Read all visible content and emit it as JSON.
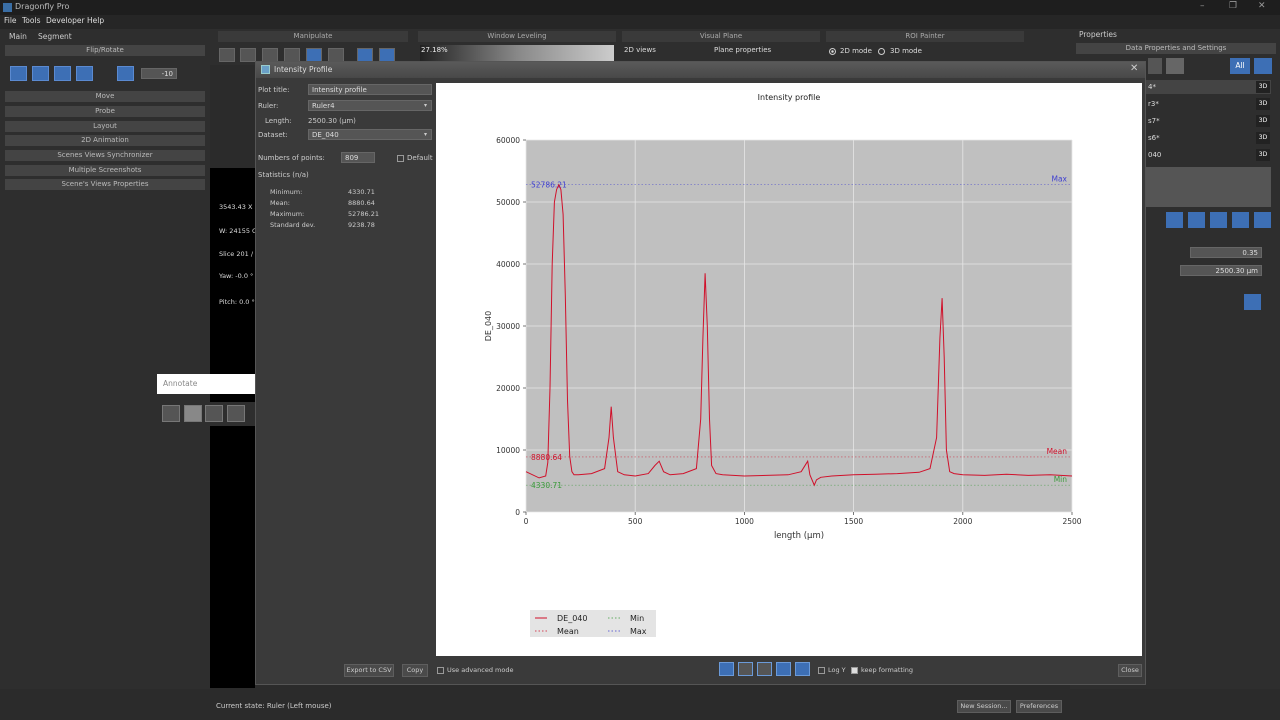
{
  "app": {
    "title": "Dragonfly Pro",
    "win_controls": [
      "–",
      "❐",
      "✕"
    ]
  },
  "menubar": {
    "items": [
      "File",
      "Tools",
      "Developer",
      "Help"
    ]
  },
  "left_panel": {
    "tabs": [
      "Main",
      "Segment"
    ],
    "flip_rotate_header": "Flip/Rotate",
    "rotate_value": "-10",
    "sections": [
      "Move",
      "Probe",
      "Layout",
      "2D Animation",
      "Scenes Views Synchronizer",
      "Multiple Screenshots",
      "Scene's Views Properties"
    ]
  },
  "viewer": {
    "lines": [
      "3543.43 X 2",
      "W: 24155 C",
      "Slice 201 /",
      "Yaw: -0.0 °",
      "Pitch: 0.0 °"
    ]
  },
  "annotate": {
    "label": "Annotate"
  },
  "top_strip": {
    "headers": [
      "Manipulate",
      "Window Leveling",
      "Visual Plane",
      "ROI Painter"
    ],
    "window_level_text": "27.18%",
    "views_2d": "2D views",
    "plane_properties": "Plane properties",
    "mode_2d": "2D mode",
    "mode_3d": "3D mode"
  },
  "right_panel": {
    "header": "Properties",
    "subheader": "Data Properties and Settings",
    "all_btn": "All",
    "rows": [
      {
        "name": "4*",
        "tag": "3D"
      },
      {
        "name": "r3*",
        "tag": "3D"
      },
      {
        "name": "s7*",
        "tag": "3D"
      },
      {
        "name": "s6*",
        "tag": "3D"
      },
      {
        "name": "040",
        "tag": "3D"
      }
    ],
    "value1": "0.35",
    "value2": "2500.30 μm"
  },
  "dialog": {
    "title": "Intensity Profile",
    "plot_title_label": "Plot title:",
    "plot_title_value": "Intensity profile",
    "ruler_label": "Ruler:",
    "ruler_value": "Ruler4",
    "length_label": "Length:",
    "length_value": "2500.30 (μm)",
    "dataset_label": "Dataset:",
    "dataset_value": "DE_040",
    "num_points_label": "Numbers of points:",
    "num_points_value": "809",
    "default_label": "Default",
    "stats_header": "Statistics (n/a)",
    "stats": [
      {
        "label": "Minimum:",
        "value": "4330.71"
      },
      {
        "label": "Mean:",
        "value": "8880.64"
      },
      {
        "label": "Maximum:",
        "value": "52786.21"
      },
      {
        "label": "Standard dev.",
        "value": "9238.78"
      }
    ],
    "export_btn": "Export to CSV",
    "copy_btn": "Copy",
    "advanced_label": "Use advanced mode",
    "logy_label": "Log Y",
    "keep_format_label": "keep formatting",
    "close_btn": "Close"
  },
  "status": {
    "text": "Current state: Ruler (Left mouse)",
    "new_session": "New Session...",
    "preferences": "Preferences"
  },
  "chart_data": {
    "type": "line",
    "title": "Intensity profile",
    "xlabel": "length (μm)",
    "ylabel": "DE_040",
    "xlim": [
      0,
      2500
    ],
    "ylim": [
      0,
      60000
    ],
    "xticks": [
      "0",
      "500",
      "1000",
      "1500",
      "2000",
      "2500"
    ],
    "yticks": [
      "0",
      "10000",
      "20000",
      "30000",
      "40000",
      "50000",
      "60000"
    ],
    "grid": true,
    "background": "#c0c0c0",
    "series": [
      {
        "name": "DE_040",
        "color": "#d0102a",
        "x": [
          0,
          60,
          90,
          100,
          110,
          120,
          130,
          140,
          150,
          160,
          170,
          180,
          190,
          200,
          210,
          220,
          240,
          300,
          360,
          380,
          390,
          400,
          420,
          450,
          500,
          560,
          590,
          610,
          630,
          660,
          720,
          780,
          800,
          810,
          820,
          830,
          840,
          850,
          870,
          900,
          1000,
          1100,
          1200,
          1260,
          1290,
          1300,
          1320,
          1330,
          1350,
          1400,
          1500,
          1600,
          1700,
          1800,
          1850,
          1880,
          1895,
          1905,
          1915,
          1925,
          1940,
          1960,
          2000,
          2100,
          2200,
          2300,
          2400,
          2500
        ],
        "y": [
          6500,
          5500,
          5800,
          8000,
          20000,
          40000,
          50000,
          52000,
          52786,
          52000,
          48000,
          35000,
          18000,
          9000,
          6500,
          6000,
          6000,
          6200,
          7000,
          12000,
          17000,
          12000,
          6500,
          6000,
          5800,
          6200,
          7500,
          8200,
          6500,
          6000,
          6200,
          7000,
          15000,
          28000,
          38500,
          30000,
          15000,
          7500,
          6200,
          6000,
          5800,
          5900,
          6000,
          6500,
          8200,
          6000,
          4330,
          5200,
          5600,
          5800,
          6000,
          6100,
          6200,
          6400,
          7000,
          12000,
          28000,
          34500,
          25000,
          10000,
          6500,
          6200,
          6000,
          5900,
          6100,
          5900,
          6000,
          5800
        ]
      }
    ],
    "lines": {
      "max": {
        "value": 52786.21,
        "label": "Max",
        "value_label": "52786.21",
        "color": "#4040d0"
      },
      "mean": {
        "value": 8880.64,
        "label": "Mean",
        "value_label": "8880.64",
        "color": "#d0102a"
      },
      "min": {
        "value": 4330.71,
        "label": "Min",
        "value_label": "4330.71",
        "color": "#3a9a3a"
      }
    },
    "legend": {
      "position": "bottom-left",
      "entries": [
        "DE_040",
        "Min",
        "Mean",
        "Max"
      ]
    }
  }
}
